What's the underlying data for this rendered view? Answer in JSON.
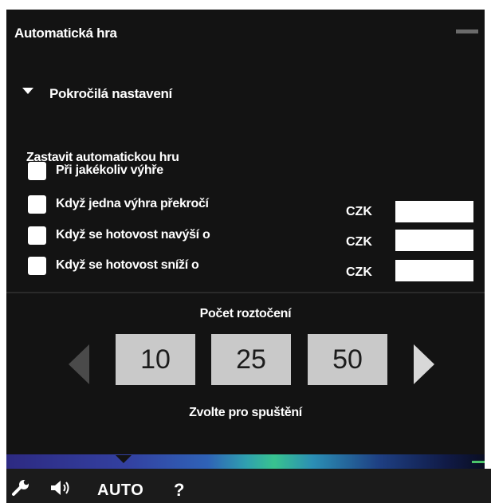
{
  "panel": {
    "title": "Automatická hra"
  },
  "advanced": {
    "label": "Pokročilá nastavení"
  },
  "stop": {
    "title": "Zastavit automatickou hru",
    "options": [
      {
        "label": "Při jakékoliv výhře"
      },
      {
        "label": "Když jedna výhra překročí",
        "currency": "CZK",
        "value": ""
      },
      {
        "label": "Když se hotovost navýší o",
        "currency": "CZK",
        "value": ""
      },
      {
        "label": "Když se hotovost sníží o",
        "currency": "CZK",
        "value": ""
      }
    ]
  },
  "spins": {
    "title": "Počet roztočení",
    "options": [
      "10",
      "25",
      "50"
    ],
    "hint": "Zvolte pro spuštění"
  },
  "toolbar": {
    "auto_label": "AUTO",
    "help_label": "?",
    "icons": [
      "wrench-icon",
      "speaker-icon"
    ]
  }
}
